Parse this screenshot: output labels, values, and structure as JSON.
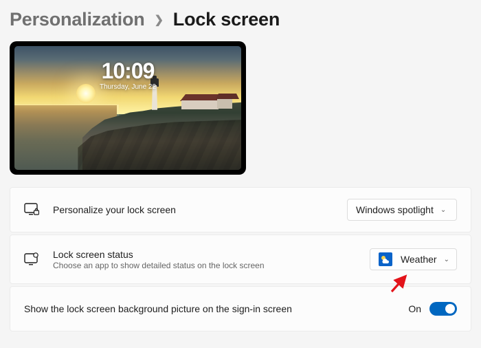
{
  "breadcrumb": {
    "parent": "Personalization",
    "current": "Lock screen"
  },
  "preview": {
    "time": "10:09",
    "date": "Thursday, June 22"
  },
  "rows": {
    "personalize": {
      "title": "Personalize your lock screen",
      "dropdown_label": "Windows spotlight"
    },
    "status": {
      "title": "Lock screen status",
      "desc": "Choose an app to show detailed status on the lock screen",
      "dropdown_label": "Weather"
    },
    "signin_bg": {
      "title": "Show the lock screen background picture on the sign-in screen",
      "toggle_label": "On",
      "toggle_on": true
    }
  }
}
